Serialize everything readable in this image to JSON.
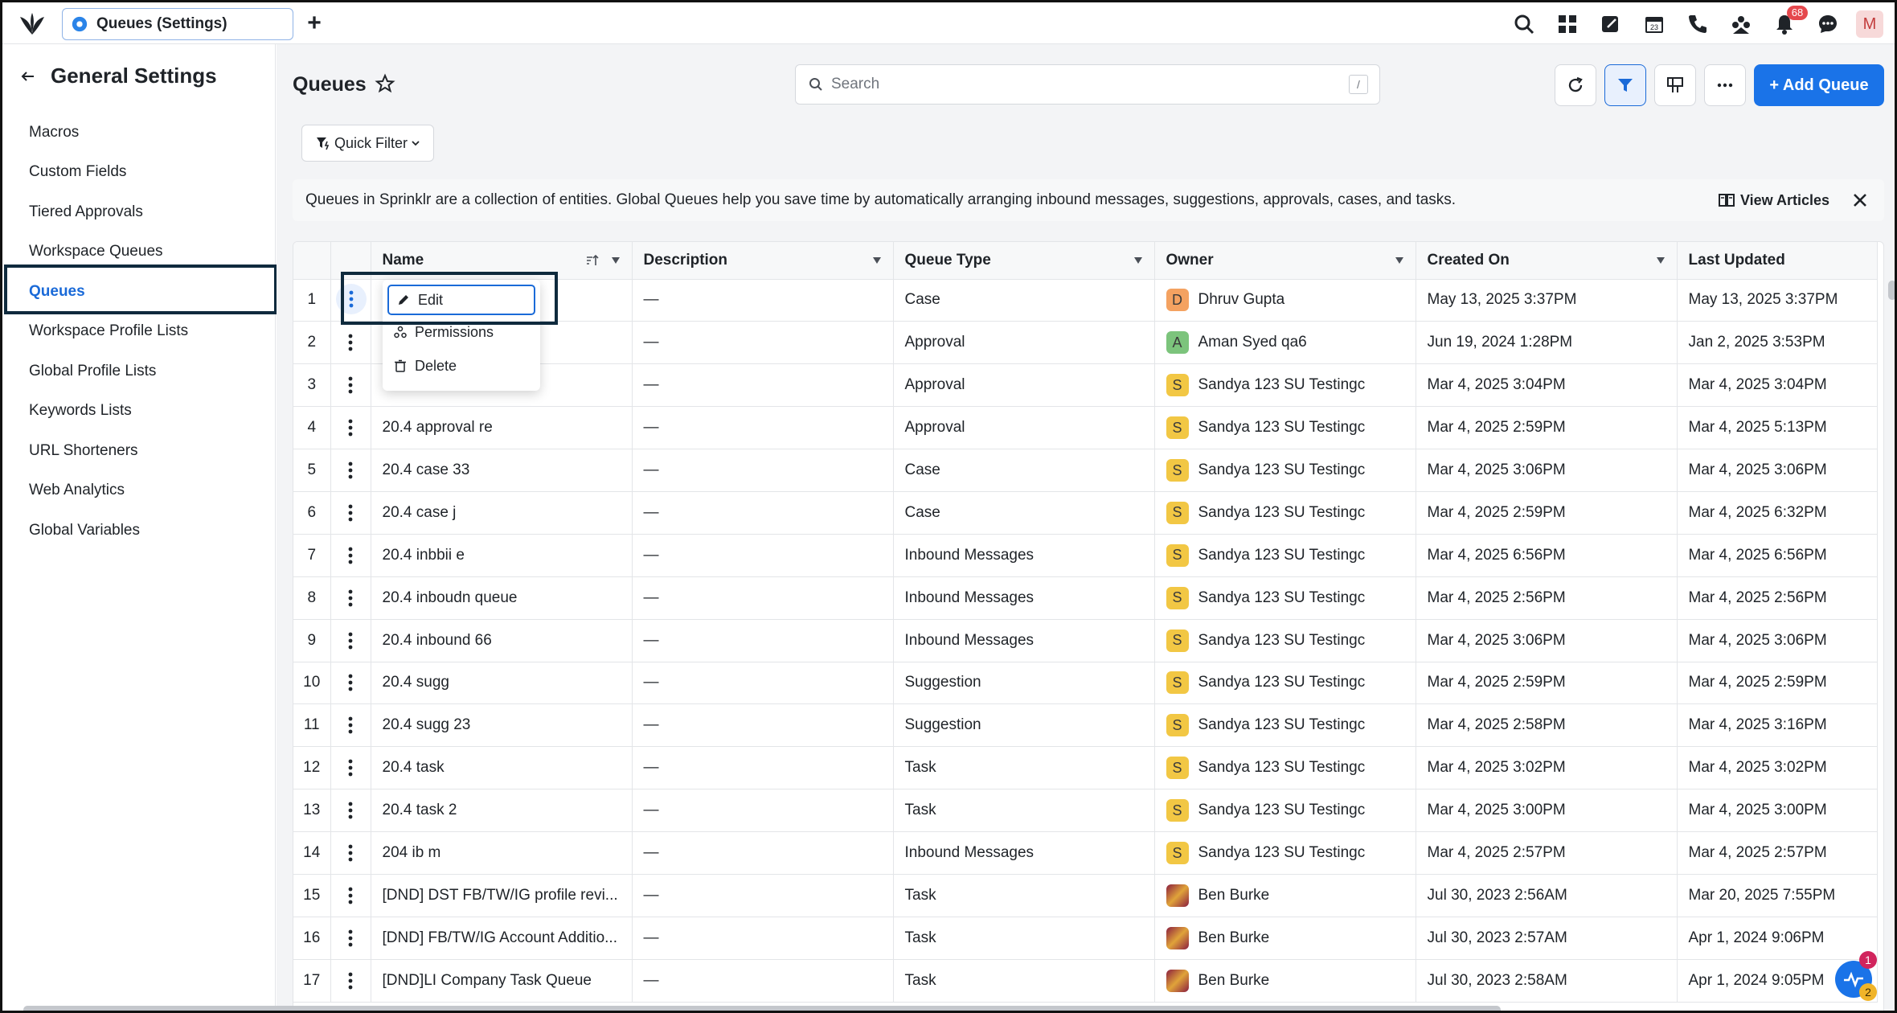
{
  "window": {
    "tab_title": "Queues (Settings)"
  },
  "topbar": {
    "notification_count": "68",
    "user_initial": "M"
  },
  "sidebar": {
    "title": "General Settings",
    "items": [
      {
        "label": "Macros"
      },
      {
        "label": "Custom Fields"
      },
      {
        "label": "Tiered Approvals"
      },
      {
        "label": "Workspace Queues"
      },
      {
        "label": "Queues"
      },
      {
        "label": "Workspace Profile Lists"
      },
      {
        "label": "Global Profile Lists"
      },
      {
        "label": "Keywords Lists"
      },
      {
        "label": "URL Shorteners"
      },
      {
        "label": "Web Analytics"
      },
      {
        "label": "Global Variables"
      }
    ],
    "active_item": "Queues"
  },
  "header": {
    "title": "Queues",
    "search_placeholder": "Search",
    "search_shortcut": "/",
    "add_button": "+ Add Queue"
  },
  "filters": {
    "quick_filter_label": "Quick Filter"
  },
  "info": {
    "text": "Queues in Sprinklr are a collection of entities. Global Queues help you save time by automatically arranging inbound messages, suggestions, approvals, cases, and tasks.",
    "view_articles": "View Articles"
  },
  "context_menu": {
    "items": [
      {
        "label": "Edit"
      },
      {
        "label": "Permissions"
      },
      {
        "label": "Delete"
      }
    ]
  },
  "table": {
    "columns": [
      "Name",
      "Description",
      "Queue Type",
      "Owner",
      "Created On",
      "Last Updated"
    ],
    "rows": [
      {
        "num": "1",
        "name": "",
        "description": "—",
        "type": "Case",
        "owner": "Dhruv Gupta",
        "owner_initial": "D",
        "owner_color": "#f4a261",
        "created": "May 13, 2025 3:37PM",
        "updated": "May 13, 2025 3:37PM"
      },
      {
        "num": "2",
        "name": "",
        "description": "—",
        "type": "Approval",
        "owner": "Aman Syed qa6",
        "owner_initial": "A",
        "owner_color": "#7cc47c",
        "created": "Jun 19, 2024 1:28PM",
        "updated": "Jan 2, 2025 3:53PM"
      },
      {
        "num": "3",
        "name": "",
        "description": "—",
        "type": "Approval",
        "owner": "Sandya 123 SU Testingc",
        "owner_initial": "S",
        "owner_color": "#f2c744",
        "created": "Mar 4, 2025 3:04PM",
        "updated": "Mar 4, 2025 3:04PM"
      },
      {
        "num": "4",
        "name": "20.4 approval  re",
        "description": "—",
        "type": "Approval",
        "owner": "Sandya 123 SU Testingc",
        "owner_initial": "S",
        "owner_color": "#f2c744",
        "created": "Mar 4, 2025 2:59PM",
        "updated": "Mar 4, 2025 5:13PM"
      },
      {
        "num": "5",
        "name": "20.4 case 33",
        "description": "—",
        "type": "Case",
        "owner": "Sandya 123 SU Testingc",
        "owner_initial": "S",
        "owner_color": "#f2c744",
        "created": "Mar 4, 2025 3:06PM",
        "updated": "Mar 4, 2025 3:06PM"
      },
      {
        "num": "6",
        "name": "20.4 case j",
        "description": "—",
        "type": "Case",
        "owner": "Sandya 123 SU Testingc",
        "owner_initial": "S",
        "owner_color": "#f2c744",
        "created": "Mar 4, 2025 2:59PM",
        "updated": "Mar 4, 2025 6:32PM"
      },
      {
        "num": "7",
        "name": "20.4 inbbii e",
        "description": "—",
        "type": "Inbound Messages",
        "owner": "Sandya 123 SU Testingc",
        "owner_initial": "S",
        "owner_color": "#f2c744",
        "created": "Mar 4, 2025 6:56PM",
        "updated": "Mar 4, 2025 6:56PM"
      },
      {
        "num": "8",
        "name": "20.4 inboudn queue",
        "description": "—",
        "type": "Inbound Messages",
        "owner": "Sandya 123 SU Testingc",
        "owner_initial": "S",
        "owner_color": "#f2c744",
        "created": "Mar 4, 2025 2:56PM",
        "updated": "Mar 4, 2025 2:56PM"
      },
      {
        "num": "9",
        "name": "20.4 inbound 66",
        "description": "—",
        "type": "Inbound Messages",
        "owner": "Sandya 123 SU Testingc",
        "owner_initial": "S",
        "owner_color": "#f2c744",
        "created": "Mar 4, 2025 3:06PM",
        "updated": "Mar 4, 2025 3:06PM"
      },
      {
        "num": "10",
        "name": "20.4 sugg",
        "description": "—",
        "type": "Suggestion",
        "owner": "Sandya 123 SU Testingc",
        "owner_initial": "S",
        "owner_color": "#f2c744",
        "created": "Mar 4, 2025 2:59PM",
        "updated": "Mar 4, 2025 2:59PM"
      },
      {
        "num": "11",
        "name": "20.4 sugg 23",
        "description": "—",
        "type": "Suggestion",
        "owner": "Sandya 123 SU Testingc",
        "owner_initial": "S",
        "owner_color": "#f2c744",
        "created": "Mar 4, 2025 2:58PM",
        "updated": "Mar 4, 2025 3:16PM"
      },
      {
        "num": "12",
        "name": "20.4 task",
        "description": "—",
        "type": "Task",
        "owner": "Sandya 123 SU Testingc",
        "owner_initial": "S",
        "owner_color": "#f2c744",
        "created": "Mar 4, 2025 3:02PM",
        "updated": "Mar 4, 2025 3:02PM"
      },
      {
        "num": "13",
        "name": "20.4 task 2",
        "description": "—",
        "type": "Task",
        "owner": "Sandya 123 SU Testingc",
        "owner_initial": "S",
        "owner_color": "#f2c744",
        "created": "Mar 4, 2025 3:00PM",
        "updated": "Mar 4, 2025 3:00PM"
      },
      {
        "num": "14",
        "name": "204 ib m",
        "description": "—",
        "type": "Inbound Messages",
        "owner": "Sandya 123 SU Testingc",
        "owner_initial": "S",
        "owner_color": "#f2c744",
        "created": "Mar 4, 2025 2:57PM",
        "updated": "Mar 4, 2025 2:57PM"
      },
      {
        "num": "15",
        "name": "[DND] DST FB/TW/IG profile revi...",
        "description": "—",
        "type": "Task",
        "owner": "Ben Burke",
        "owner_initial": "",
        "owner_color": "#8b1e3f",
        "created": "Jul 30, 2023 2:56AM",
        "updated": "Mar 20, 2025 7:55PM"
      },
      {
        "num": "16",
        "name": "[DND] FB/TW/IG Account Additio...",
        "description": "—",
        "type": "Task",
        "owner": "Ben Burke",
        "owner_initial": "",
        "owner_color": "#8b1e3f",
        "created": "Jul 30, 2023 2:57AM",
        "updated": "Apr 1, 2024 9:06PM"
      },
      {
        "num": "17",
        "name": "[DND]LI Company Task Queue",
        "description": "—",
        "type": "Task",
        "owner": "Ben Burke",
        "owner_initial": "",
        "owner_color": "#8b1e3f",
        "created": "Jul 30, 2023 2:58AM",
        "updated": "Apr 1, 2024 9:05PM"
      }
    ]
  },
  "help_widget": {
    "badge_top": "1",
    "badge_bottom": "2"
  },
  "colors": {
    "accent": "#1a73e8",
    "active_text": "#1a6ad8",
    "highlight_border": "#0f2a3d"
  }
}
